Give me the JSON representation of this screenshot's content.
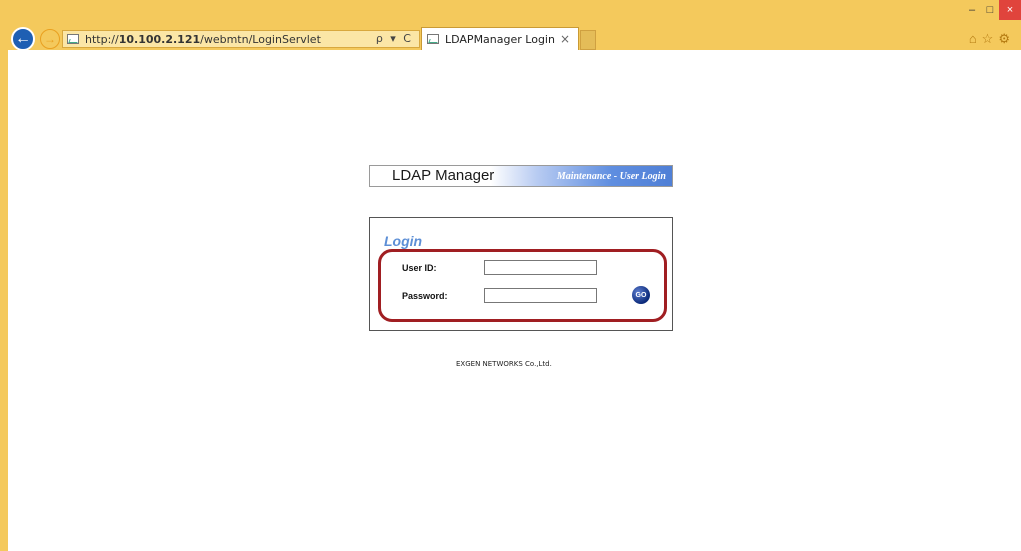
{
  "browser": {
    "address_scheme": "http://",
    "address_host": "10.100.2.121",
    "address_path": "/webmtn/LoginServlet",
    "address_tools": "ρ ▾ C",
    "tab_title": "LDAPManager Login",
    "tab_close": "×",
    "back_icon": "←",
    "forward_icon": "→",
    "window_min": "–",
    "window_max": "□",
    "window_close": "×",
    "right_icons": "⌂☆⚙"
  },
  "page": {
    "banner_title": "LDAP Manager",
    "banner_subtitle": "Maintenance - User Login",
    "login_title": "Login",
    "userid_label": "User ID:",
    "password_label": "Password:",
    "userid_value": "",
    "password_value": "",
    "go_label": "GO",
    "footer": "EXGEN NETWORKS Co.,Ltd."
  },
  "colors": {
    "chrome": "#f4c95c",
    "highlight": "#a01e22",
    "login_title": "#5d8fd6"
  }
}
